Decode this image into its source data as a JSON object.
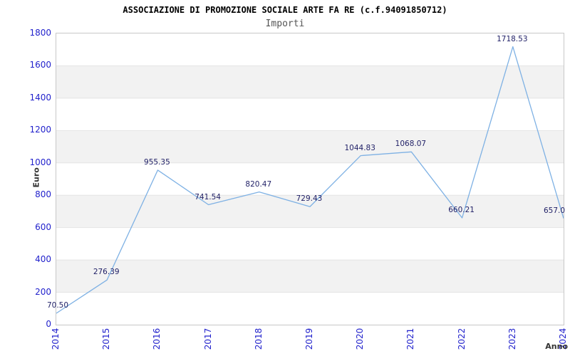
{
  "header": {
    "title": "ASSOCIAZIONE DI PROMOZIONE SOCIALE ARTE FA RE (c.f.94091850712)",
    "subtitle": "Importi"
  },
  "chart_data": {
    "type": "line",
    "title": "ASSOCIAZIONE DI PROMOZIONE SOCIALE ARTE FA RE (c.f.94091850712)",
    "subtitle": "Importi",
    "xlabel": "Anno",
    "ylabel": "Euro",
    "x": [
      "2014",
      "2015",
      "2016",
      "2017",
      "2018",
      "2019",
      "2020",
      "2021",
      "2022",
      "2023",
      "2024"
    ],
    "series": [
      {
        "name": "Importi",
        "values": [
          70.5,
          276.39,
          955.35,
          741.54,
          820.47,
          729.43,
          1044.83,
          1068.07,
          660.21,
          1718.53,
          657.0
        ],
        "point_labels": [
          "70.50",
          "276.39",
          "955.35",
          "741.54",
          "820.47",
          "729.43",
          "1044.83",
          "1068.07",
          "660.21",
          "1718.53",
          "657.0"
        ]
      }
    ],
    "ylim": [
      0,
      1800
    ],
    "yticks": [
      "0",
      "200",
      "400",
      "600",
      "800",
      "1000",
      "1200",
      "1400",
      "1600",
      "1800"
    ],
    "ytick_step": 200,
    "grid": true,
    "legend_position": "none",
    "colors": {
      "line": "#7eb1e4",
      "point_label": "#1f1f66",
      "tick_label": "#2222cc",
      "band_gray": "#f2f2f2",
      "gridline": "#e4e4e4",
      "plot_border": "#c8c8c8",
      "title": "#000000",
      "subtitle": "#555555",
      "axis_title": "#333333"
    }
  }
}
